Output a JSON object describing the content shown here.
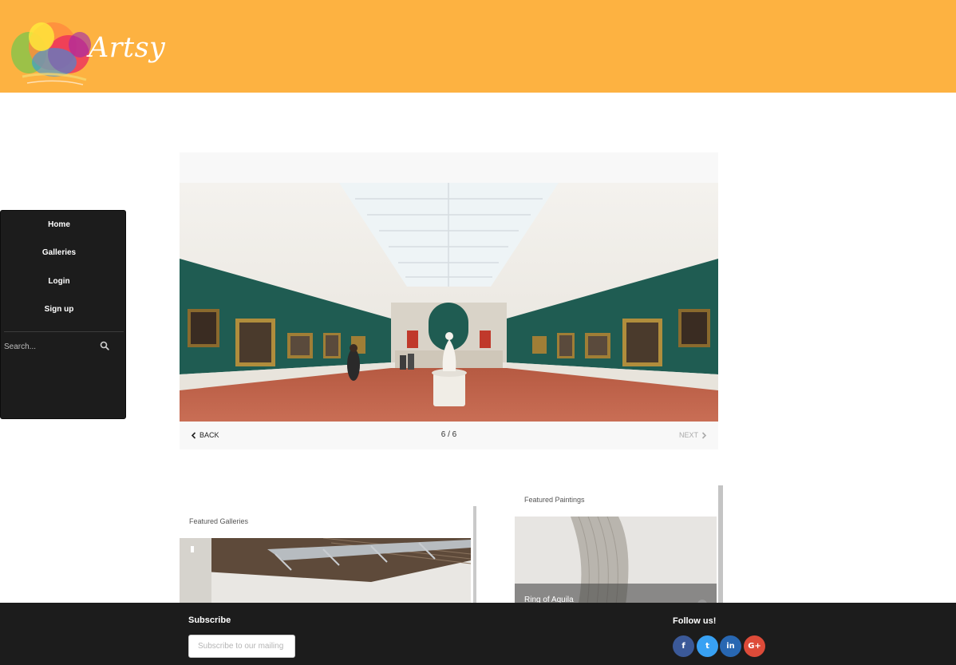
{
  "brand": {
    "name": "Artsy",
    "header_color": "#fdb241"
  },
  "sidebar": {
    "items": [
      {
        "label": "Home"
      },
      {
        "label": "Galleries"
      },
      {
        "label": "Login"
      },
      {
        "label": "Sign up"
      }
    ],
    "search_placeholder": "Search...",
    "search_icon": "search-icon"
  },
  "slider": {
    "back_label": "BACK",
    "next_label": "NEXT",
    "counter": "6 / 6",
    "current": 6,
    "total": 6
  },
  "featured_galleries": {
    "label": "Featured Galleries"
  },
  "featured_paintings": {
    "label": "Featured Paintings",
    "caption": "Ring of Aquila"
  },
  "footer": {
    "subscribe_title": "Subscribe",
    "subscribe_placeholder": "Subscribe to our mailing",
    "follow_title": "Follow us!",
    "social": [
      {
        "icon": "facebook-icon",
        "glyph": "f",
        "color": "#3b5998"
      },
      {
        "icon": "twitter-icon",
        "glyph": "t",
        "color": "#38a1f3"
      },
      {
        "icon": "linkedin-icon",
        "glyph": "in",
        "color": "#2867b2"
      },
      {
        "icon": "google-plus-icon",
        "glyph": "G+",
        "color": "#dd4b39"
      }
    ]
  }
}
